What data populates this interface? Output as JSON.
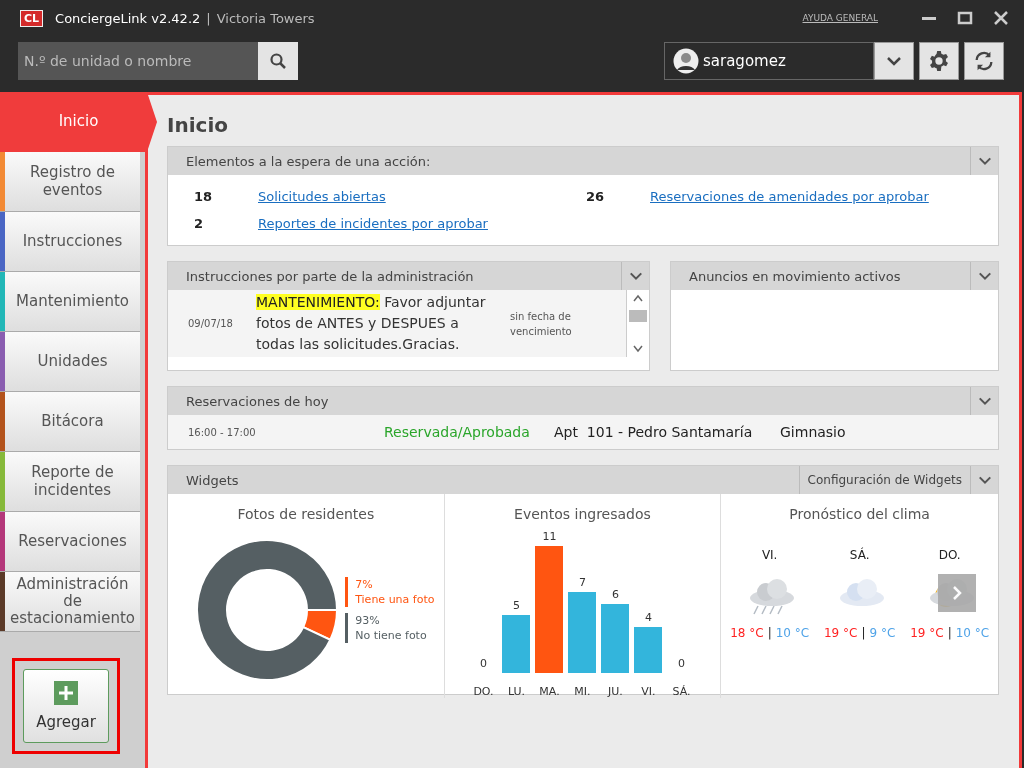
{
  "window": {
    "logo": "CL",
    "app_name": "ConciergeLink v2.42.2",
    "separator": "|",
    "site": "Victoria Towers",
    "help_link": "AYUDA GENERAL"
  },
  "search": {
    "placeholder": "N.º de unidad o nombre"
  },
  "user": {
    "name": "saragomez"
  },
  "sidebar": {
    "items": [
      {
        "label": "Inicio",
        "selected": true,
        "color": "#f03c3c"
      },
      {
        "label": "Registro de eventos",
        "selected": false,
        "color": "#f28a35"
      },
      {
        "label": "Instrucciones",
        "selected": false,
        "color": "#4a66c4"
      },
      {
        "label": "Mantenimiento",
        "selected": false,
        "color": "#22b7b7"
      },
      {
        "label": "Unidades",
        "selected": false,
        "color": "#8a5db0"
      },
      {
        "label": "Bitácora",
        "selected": false,
        "color": "#b3531c"
      },
      {
        "label": "Reporte de incidentes",
        "selected": false,
        "color": "#86b93a"
      },
      {
        "label": "Reservaciones",
        "selected": false,
        "color": "#b4377a"
      },
      {
        "label": "Administración de estacionamiento",
        "selected": false,
        "color": "#5b3a28"
      }
    ],
    "add_button": "Agregar"
  },
  "page_title": "Inicio",
  "pending": {
    "title": "Elementos a la espera de una acción:",
    "items": [
      {
        "count": "18",
        "label": "Solicitudes abiertas"
      },
      {
        "count": "26",
        "label": "Reservaciones de amenidades por aprobar"
      },
      {
        "count": "2",
        "label": "Reportes de incidentes por aprobar"
      }
    ]
  },
  "instructions": {
    "title": "Instrucciones por parte de la administración",
    "rows": [
      {
        "date": "09/07/18",
        "tag": "MANTENIMIENTO:",
        "text": "Favor adjuntar fotos de ANTES y DESPUES a todas las solicitudes.Gracias.",
        "due": "sin fecha de vencimiento"
      }
    ]
  },
  "announcements": {
    "title": "Anuncios en movimiento activos"
  },
  "reservations": {
    "title": "Reservaciones de hoy",
    "rows": [
      {
        "time": "16:00 - 17:00",
        "status": "Reservada/Aprobada",
        "unit": "Apt  101 - Pedro Santamaría",
        "amenity": "Gimnasio"
      }
    ]
  },
  "widgets": {
    "title": "Widgets",
    "settings": "Configuración de Widgets",
    "photos": {
      "title": "Fotos de residentes",
      "legend": [
        {
          "color": "#ff5511"
        },
        {
          "color": "#555f63"
        }
      ],
      "chart_data": {
        "type": "donut",
        "categories": [
          "Tiene una foto",
          "No tiene foto"
        ],
        "values": [
          7,
          93
        ],
        "value_labels": [
          "7%",
          "93%"
        ]
      }
    },
    "events": {
      "title": "Eventos ingresados",
      "chart_data": {
        "type": "bar",
        "categories": [
          "DO.",
          "LU.",
          "MA.",
          "MI.",
          "JU.",
          "VI.",
          "SÁ."
        ],
        "series": [
          {
            "color": "#33b5dc",
            "values": [
              0,
              5,
              null,
              7,
              6,
              4,
              0
            ]
          },
          {
            "color": "#ff5511",
            "values": [
              null,
              null,
              11,
              null,
              null,
              null,
              null
            ]
          }
        ],
        "data_labels": true
      }
    },
    "weather": {
      "title": "Pronóstico del clima",
      "separator": "|",
      "days": [
        {
          "day": "VI.",
          "kind": "rain",
          "high": "18 °C",
          "low": "10 °C"
        },
        {
          "day": "SÁ.",
          "kind": "cloud",
          "high": "19 °C",
          "low": "9 °C"
        },
        {
          "day": "DO.",
          "kind": "sun",
          "high": "19 °C",
          "low": "10 °C"
        }
      ]
    }
  }
}
